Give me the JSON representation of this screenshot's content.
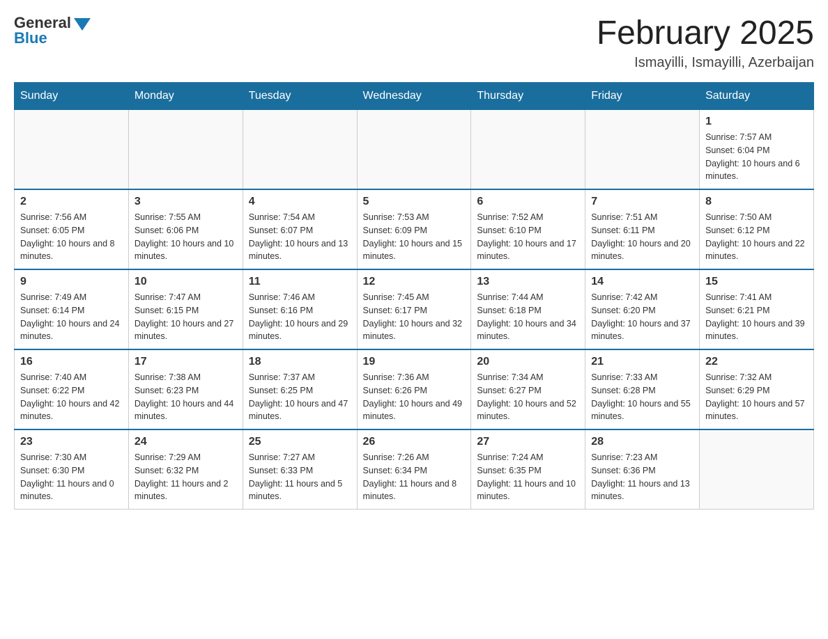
{
  "header": {
    "logo_general": "General",
    "logo_blue": "Blue",
    "title": "February 2025",
    "subtitle": "Ismayilli, Ismayilli, Azerbaijan"
  },
  "days_of_week": [
    "Sunday",
    "Monday",
    "Tuesday",
    "Wednesday",
    "Thursday",
    "Friday",
    "Saturday"
  ],
  "weeks": [
    {
      "days": [
        {
          "num": "",
          "info": ""
        },
        {
          "num": "",
          "info": ""
        },
        {
          "num": "",
          "info": ""
        },
        {
          "num": "",
          "info": ""
        },
        {
          "num": "",
          "info": ""
        },
        {
          "num": "",
          "info": ""
        },
        {
          "num": "1",
          "info": "Sunrise: 7:57 AM\nSunset: 6:04 PM\nDaylight: 10 hours and 6 minutes."
        }
      ]
    },
    {
      "days": [
        {
          "num": "2",
          "info": "Sunrise: 7:56 AM\nSunset: 6:05 PM\nDaylight: 10 hours and 8 minutes."
        },
        {
          "num": "3",
          "info": "Sunrise: 7:55 AM\nSunset: 6:06 PM\nDaylight: 10 hours and 10 minutes."
        },
        {
          "num": "4",
          "info": "Sunrise: 7:54 AM\nSunset: 6:07 PM\nDaylight: 10 hours and 13 minutes."
        },
        {
          "num": "5",
          "info": "Sunrise: 7:53 AM\nSunset: 6:09 PM\nDaylight: 10 hours and 15 minutes."
        },
        {
          "num": "6",
          "info": "Sunrise: 7:52 AM\nSunset: 6:10 PM\nDaylight: 10 hours and 17 minutes."
        },
        {
          "num": "7",
          "info": "Sunrise: 7:51 AM\nSunset: 6:11 PM\nDaylight: 10 hours and 20 minutes."
        },
        {
          "num": "8",
          "info": "Sunrise: 7:50 AM\nSunset: 6:12 PM\nDaylight: 10 hours and 22 minutes."
        }
      ]
    },
    {
      "days": [
        {
          "num": "9",
          "info": "Sunrise: 7:49 AM\nSunset: 6:14 PM\nDaylight: 10 hours and 24 minutes."
        },
        {
          "num": "10",
          "info": "Sunrise: 7:47 AM\nSunset: 6:15 PM\nDaylight: 10 hours and 27 minutes."
        },
        {
          "num": "11",
          "info": "Sunrise: 7:46 AM\nSunset: 6:16 PM\nDaylight: 10 hours and 29 minutes."
        },
        {
          "num": "12",
          "info": "Sunrise: 7:45 AM\nSunset: 6:17 PM\nDaylight: 10 hours and 32 minutes."
        },
        {
          "num": "13",
          "info": "Sunrise: 7:44 AM\nSunset: 6:18 PM\nDaylight: 10 hours and 34 minutes."
        },
        {
          "num": "14",
          "info": "Sunrise: 7:42 AM\nSunset: 6:20 PM\nDaylight: 10 hours and 37 minutes."
        },
        {
          "num": "15",
          "info": "Sunrise: 7:41 AM\nSunset: 6:21 PM\nDaylight: 10 hours and 39 minutes."
        }
      ]
    },
    {
      "days": [
        {
          "num": "16",
          "info": "Sunrise: 7:40 AM\nSunset: 6:22 PM\nDaylight: 10 hours and 42 minutes."
        },
        {
          "num": "17",
          "info": "Sunrise: 7:38 AM\nSunset: 6:23 PM\nDaylight: 10 hours and 44 minutes."
        },
        {
          "num": "18",
          "info": "Sunrise: 7:37 AM\nSunset: 6:25 PM\nDaylight: 10 hours and 47 minutes."
        },
        {
          "num": "19",
          "info": "Sunrise: 7:36 AM\nSunset: 6:26 PM\nDaylight: 10 hours and 49 minutes."
        },
        {
          "num": "20",
          "info": "Sunrise: 7:34 AM\nSunset: 6:27 PM\nDaylight: 10 hours and 52 minutes."
        },
        {
          "num": "21",
          "info": "Sunrise: 7:33 AM\nSunset: 6:28 PM\nDaylight: 10 hours and 55 minutes."
        },
        {
          "num": "22",
          "info": "Sunrise: 7:32 AM\nSunset: 6:29 PM\nDaylight: 10 hours and 57 minutes."
        }
      ]
    },
    {
      "days": [
        {
          "num": "23",
          "info": "Sunrise: 7:30 AM\nSunset: 6:30 PM\nDaylight: 11 hours and 0 minutes."
        },
        {
          "num": "24",
          "info": "Sunrise: 7:29 AM\nSunset: 6:32 PM\nDaylight: 11 hours and 2 minutes."
        },
        {
          "num": "25",
          "info": "Sunrise: 7:27 AM\nSunset: 6:33 PM\nDaylight: 11 hours and 5 minutes."
        },
        {
          "num": "26",
          "info": "Sunrise: 7:26 AM\nSunset: 6:34 PM\nDaylight: 11 hours and 8 minutes."
        },
        {
          "num": "27",
          "info": "Sunrise: 7:24 AM\nSunset: 6:35 PM\nDaylight: 11 hours and 10 minutes."
        },
        {
          "num": "28",
          "info": "Sunrise: 7:23 AM\nSunset: 6:36 PM\nDaylight: 11 hours and 13 minutes."
        },
        {
          "num": "",
          "info": ""
        }
      ]
    }
  ]
}
